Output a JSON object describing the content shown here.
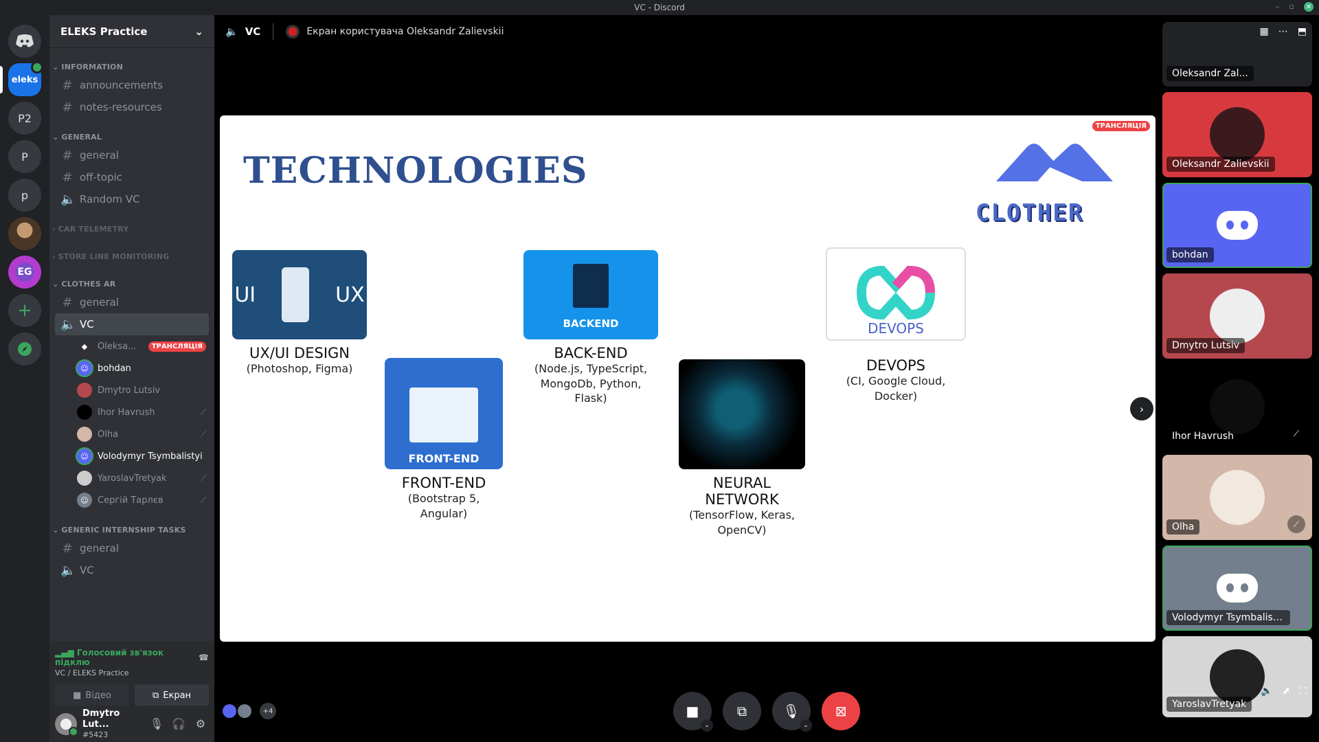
{
  "window": {
    "title": "VC - Discord"
  },
  "rail": {
    "active_label": "eleks",
    "servers": [
      "P2",
      "P",
      "p"
    ],
    "add_label": "+"
  },
  "guild": {
    "name": "ELEKS Practice",
    "categories": [
      {
        "name": "INFORMATION",
        "channels": [
          {
            "type": "text",
            "name": "announcements"
          },
          {
            "type": "text",
            "name": "notes-resources"
          }
        ]
      },
      {
        "name": "GENERAL",
        "channels": [
          {
            "type": "text",
            "name": "general"
          },
          {
            "type": "text",
            "name": "off-topic"
          },
          {
            "type": "voice",
            "name": "Random VC"
          }
        ]
      },
      {
        "name": "CAR TELEMETRY"
      },
      {
        "name": "STORE LINE MONITORING"
      },
      {
        "name": "CLOTHES AR",
        "channels": [
          {
            "type": "text",
            "name": "general"
          },
          {
            "type": "voice",
            "name": "VC"
          }
        ]
      },
      {
        "name": "GENERIC INTERNSHIP TASKS",
        "channels": [
          {
            "type": "text",
            "name": "general"
          },
          {
            "type": "voice",
            "name": "VC"
          }
        ]
      }
    ],
    "voice_users": [
      {
        "name": "Oleksa...",
        "live": "ТРАНСЛЯЦІЯ"
      },
      {
        "name": "bohdan"
      },
      {
        "name": "Dmytro Lutsiv"
      },
      {
        "name": "Ihor Havrush"
      },
      {
        "name": "Olha"
      },
      {
        "name": "Volodymyr Tsymbalistyi"
      },
      {
        "name": "YaroslavTretyak"
      },
      {
        "name": "Сергій Тарлєв"
      }
    ]
  },
  "voice_panel": {
    "status": "Голосовий зв'язок підклю",
    "location": "VC / ELEKS Practice",
    "video_label": "Відео",
    "screen_label": "Екран"
  },
  "user": {
    "name": "Dmytro Lut...",
    "tag": "#5423"
  },
  "stage": {
    "channel": "VC",
    "screen_owner": "Екран користувача Oleksandr Zalievskii",
    "live_badge": "ТРАНСЛЯЦІЯ",
    "slide": {
      "title": "TECHNOLOGIES",
      "brand": "CLOTHER",
      "cards": [
        {
          "tile_left": "UI",
          "tile_right": "UX",
          "title": "UX/UI DESIGN",
          "sub": "(Photoshop, Figma)"
        },
        {
          "tile": "FRONT-END",
          "title": "FRONT-END",
          "sub": "(Bootstrap 5, Angular)"
        },
        {
          "tile": "BACKEND",
          "title": "BACK-END",
          "sub": "(Node.js, TypeScript, MongoDb, Python, Flask)"
        },
        {
          "title": "NEURAL NETWORK",
          "sub": "(TensorFlow, Keras, OpenCV)"
        },
        {
          "tile": "DEVOPS",
          "title": "DEVOPS",
          "sub": "(CI, Google Cloud, Docker)"
        }
      ]
    },
    "extra_count": "+4"
  },
  "participants": [
    {
      "name": "Oleksandr Zal...",
      "kind": "screen"
    },
    {
      "name": "Oleksandr Zalievskii",
      "color": "#d63a3f"
    },
    {
      "name": "bohdan",
      "color": "#5865f2"
    },
    {
      "name": "Dmytro Lutsiv",
      "color": "#b5484e"
    },
    {
      "name": "Ihor Havrush",
      "color": "#000000"
    },
    {
      "name": "Olha",
      "color": "#d3b7a8"
    },
    {
      "name": "Volodymyr Tsymbalistyi",
      "color": "#747f8d"
    },
    {
      "name": "YaroslavTretyak",
      "color": "#d6d6d6"
    }
  ],
  "colors": {
    "accent": "#5865f2",
    "live": "#ed4245",
    "online": "#3ba55c"
  }
}
